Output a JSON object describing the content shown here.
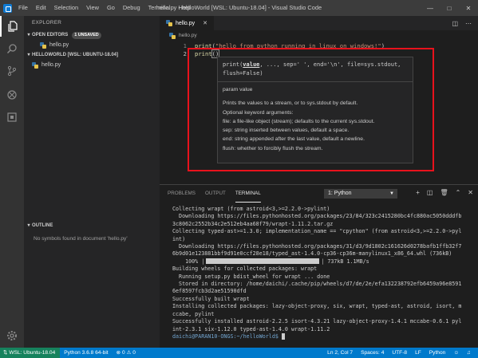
{
  "titlebar": {
    "menu": [
      "File",
      "Edit",
      "Selection",
      "View",
      "Go",
      "Debug",
      "Terminal",
      "Help"
    ],
    "title": "hello.py - helloWorld [WSL: Ubuntu-18.04] - Visual Studio Code"
  },
  "sidebar": {
    "title": "EXPLORER",
    "open_editors": {
      "label": "OPEN EDITORS",
      "badge": "1 UNSAVED",
      "files": [
        "hello.py"
      ]
    },
    "workspace": {
      "label": "HELLOWORLD [WSL: UBUNTU-18.04]",
      "files": [
        "hello.py"
      ]
    },
    "outline": {
      "label": "OUTLINE",
      "empty_text": "No symbols found in document 'hello.py'"
    }
  },
  "editor": {
    "tab": "hello.py",
    "breadcrumb": "hello.py",
    "lines": [
      {
        "num": "1",
        "fn": "print",
        "open": "(",
        "str": "\"hello from python running in linux on windows!\"",
        "close": ")"
      },
      {
        "num": "2",
        "fn": "print",
        "brackets": "()"
      }
    ]
  },
  "hover": {
    "sig_prefix": "print(",
    "sig_param": "value",
    "sig_rest": ", ..., sep=' ', end='\\n', file=sys.stdout,\nflush=False)",
    "param_line": "param value",
    "desc": "Prints the values to a stream, or to sys.stdout by default.",
    "optional": "Optional keyword arguments:",
    "args": [
      "file:  a file-like object (stream); defaults to the current sys.stdout.",
      "sep:   string inserted between values, default a space.",
      "end:   string appended after the last value, default a newline.",
      "flush: whether to forcibly flush the stream."
    ]
  },
  "panel": {
    "tabs": [
      "PROBLEMS",
      "OUTPUT",
      "TERMINAL"
    ],
    "active_tab": "TERMINAL",
    "terminal_select": "1: Python",
    "terminal_lines_a": [
      "Collecting wrapt (from astroid<3,>=2.2.0->pylint)",
      "  Downloading https://files.pythonhosted.org/packages/23/84/323c2415280bc4fc880ac5050dddfb",
      "3c8062c2552b34c2e512eb4aa68f79/wrapt-1.11.2.tar.gz",
      "Collecting typed-ast>=1.3.0; implementation_name == \"cpython\" (from astroid<3,>=2.2.0->pyl",
      "int)",
      "  Downloading https://files.pythonhosted.org/packages/31/d3/9d1802c161626d0278bafb1ffb32f7",
      "6b9d01e123881bbf9d91e0ccf28e18/typed_ast-1.4.0-cp36-cp36m-manylinux1_x86_64.whl (736kB)"
    ],
    "progress_left": "    100% |",
    "progress_right": "| 737kB 1.1MB/s",
    "terminal_lines_b": [
      "Building wheels for collected packages: wrapt",
      "  Running setup.py bdist_wheel for wrapt ... done",
      "  Stored in directory: /home/daichi/.cache/pip/wheels/d7/de/2e/efa132238792efb6459a96e8591",
      "6ef8597fcb3d2ae51590dfd",
      "Successfully built wrapt",
      "Installing collected packages: lazy-object-proxy, six, wrapt, typed-ast, astroid, isort, m",
      "ccabe, pylint",
      "Successfully installed astroid-2.2.5 isort-4.3.21 lazy-object-proxy-1.4.1 mccabe-0.6.1 pyl",
      "int-2.3.1 six-1.12.0 typed-ast-1.4.0 wrapt-1.11.2"
    ],
    "prompt": "daichi@PARAN10-ONGS:~/helloWorld$"
  },
  "statusbar": {
    "remote": "WSL: Ubuntu-18.04",
    "interpreter": "Python 3.6.8 64-bit",
    "errors": "0",
    "warnings": "0",
    "position": "Ln 2, Col 7",
    "spaces": "Spaces: 4",
    "encoding": "UTF-8",
    "eol": "LF",
    "language": "Python"
  },
  "colors": {
    "accent": "#007acc",
    "remote": "#16825d",
    "annotation": "#e8121c"
  }
}
